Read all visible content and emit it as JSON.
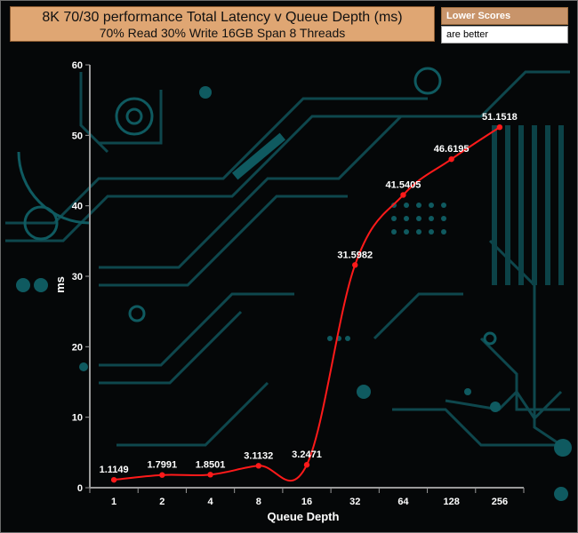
{
  "title": "8K 70/30 performance Total Latency v Queue Depth (ms)",
  "subtitle": "70% Read 30% Write 16GB Span 8 Threads",
  "note": {
    "line1": "Lower Scores",
    "line2": "are better"
  },
  "chart_data": {
    "type": "line",
    "title": "8K 70/30 performance Total Latency v Queue Depth (ms)",
    "subtitle": "70% Read 30% Write 16GB Span 8 Threads",
    "xlabel": "Queue Depth",
    "ylabel": "ms",
    "categories": [
      "1",
      "2",
      "4",
      "8",
      "16",
      "32",
      "64",
      "128",
      "256"
    ],
    "series": [
      {
        "values": [
          1.1149,
          1.7991,
          1.8501,
          3.1132,
          3.2471,
          31.5982,
          41.5405,
          46.6195,
          51.1518
        ]
      }
    ],
    "data_labels": [
      "1.1149",
      "1.7991",
      "1.8501",
      "3.1132",
      "3.2471",
      "31.5982",
      "41.5405",
      "46.6195",
      "51.1518"
    ],
    "ylim": [
      0,
      60
    ],
    "yticks": [
      "0",
      "10",
      "20",
      "30",
      "40",
      "50",
      "60"
    ],
    "grid": false,
    "legend": "none",
    "colors": {
      "line": "#ff1a1a",
      "axis": "#9a9a9a",
      "text": "#ffffff",
      "title_bg": "#dfa673",
      "circuit": "#0f5a60"
    }
  }
}
